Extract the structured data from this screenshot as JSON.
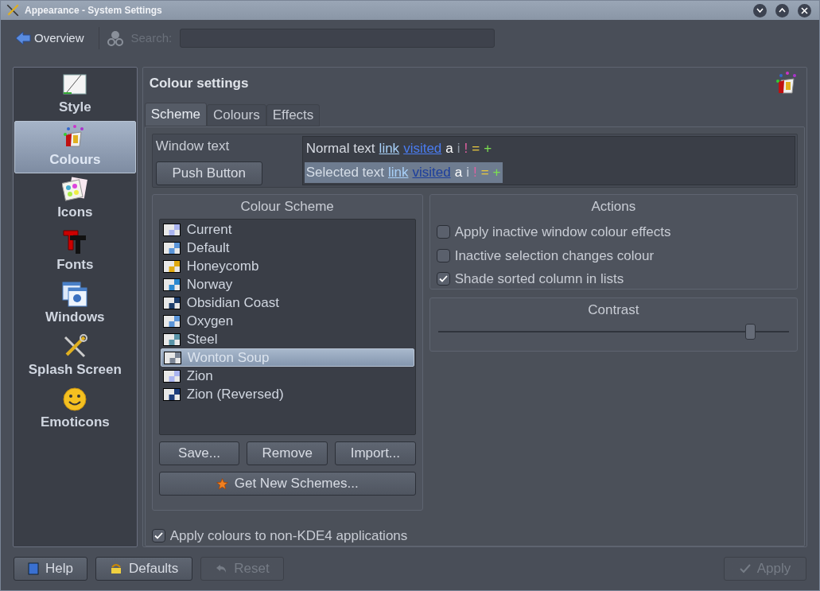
{
  "window": {
    "title": "Appearance - System Settings"
  },
  "toolbar": {
    "overview": "Overview",
    "search_label": "Search:",
    "search": {
      "disabled": true
    }
  },
  "sidebar": {
    "items": [
      {
        "label": "Style",
        "kind": "style",
        "selected": false
      },
      {
        "label": "Colours",
        "kind": "colours",
        "selected": true
      },
      {
        "label": "Icons",
        "kind": "icons",
        "selected": false
      },
      {
        "label": "Fonts",
        "kind": "fonts",
        "selected": false
      },
      {
        "label": "Windows",
        "kind": "windows",
        "selected": false
      },
      {
        "label": "Splash Screen",
        "kind": "splash",
        "selected": false
      },
      {
        "label": "Emoticons",
        "kind": "emoticons",
        "selected": false
      }
    ]
  },
  "page": {
    "title": "Colour settings",
    "tabs": [
      {
        "label": "Scheme",
        "selected": true
      },
      {
        "label": "Colours",
        "selected": false
      },
      {
        "label": "Effects",
        "selected": false
      }
    ],
    "preview": {
      "window_text": "Window text",
      "push_button": "Push Button",
      "rows": [
        {
          "selected": false,
          "tokens": [
            {
              "text": "Normal text",
              "kind": "plain"
            },
            {
              "text": "link",
              "kind": "link"
            },
            {
              "text": "visited",
              "kind": "visited"
            },
            {
              "text": "a",
              "kind": "active"
            },
            {
              "text": "i",
              "kind": "inactive"
            },
            {
              "text": "!",
              "kind": "negative"
            },
            {
              "text": "=",
              "kind": "neutral"
            },
            {
              "text": "+",
              "kind": "positive"
            }
          ]
        },
        {
          "selected": true,
          "tokens": [
            {
              "text": "Selected text",
              "kind": "plain"
            },
            {
              "text": "link",
              "kind": "link"
            },
            {
              "text": "visited",
              "kind": "visited"
            },
            {
              "text": "a",
              "kind": "active"
            },
            {
              "text": "i",
              "kind": "inactive"
            },
            {
              "text": "!",
              "kind": "negative"
            },
            {
              "text": "=",
              "kind": "neutral"
            },
            {
              "text": "+",
              "kind": "positive"
            }
          ]
        }
      ]
    },
    "scheme": {
      "title": "Colour Scheme",
      "items": [
        {
          "label": "Current",
          "color": "#aab4f0",
          "selected": false
        },
        {
          "label": "Default",
          "color": "#5a94d8",
          "selected": false
        },
        {
          "label": "Honeycomb",
          "color": "#e0aa10",
          "selected": false
        },
        {
          "label": "Norway",
          "color": "#2a88d0",
          "selected": false
        },
        {
          "label": "Obsidian Coast",
          "color": "#1c3c6a",
          "selected": false
        },
        {
          "label": "Oxygen",
          "color": "#5a94d8",
          "selected": false
        },
        {
          "label": "Steel",
          "color": "#5a94a8",
          "selected": false
        },
        {
          "label": "Wonton Soup",
          "color": "#7a8494",
          "selected": true
        },
        {
          "label": "Zion",
          "color": "#aab4f0",
          "selected": false
        },
        {
          "label": "Zion (Reversed)",
          "color": "#1c3c7a",
          "selected": false
        }
      ],
      "buttons": [
        "Save...",
        "Remove",
        "Import..."
      ],
      "get_new": "Get New Schemes..."
    },
    "actions": {
      "title": "Actions",
      "options": [
        {
          "label": "Apply inactive window colour effects",
          "checked": false
        },
        {
          "label": "Inactive selection changes colour",
          "checked": false
        },
        {
          "label": "Shade sorted column in lists",
          "checked": true
        }
      ]
    },
    "contrast": {
      "title": "Contrast",
      "level": 0.89
    },
    "apply_non_kde": {
      "label": "Apply colours to non-KDE4 applications",
      "checked": true
    }
  },
  "buttons": [
    {
      "label": "Help",
      "kind": "help",
      "disabled": false
    },
    {
      "label": "Defaults",
      "kind": "defaults",
      "disabled": false
    },
    {
      "label": "Reset",
      "kind": "reset",
      "disabled": true
    },
    {
      "label": "Apply",
      "kind": "apply",
      "disabled": true
    }
  ]
}
